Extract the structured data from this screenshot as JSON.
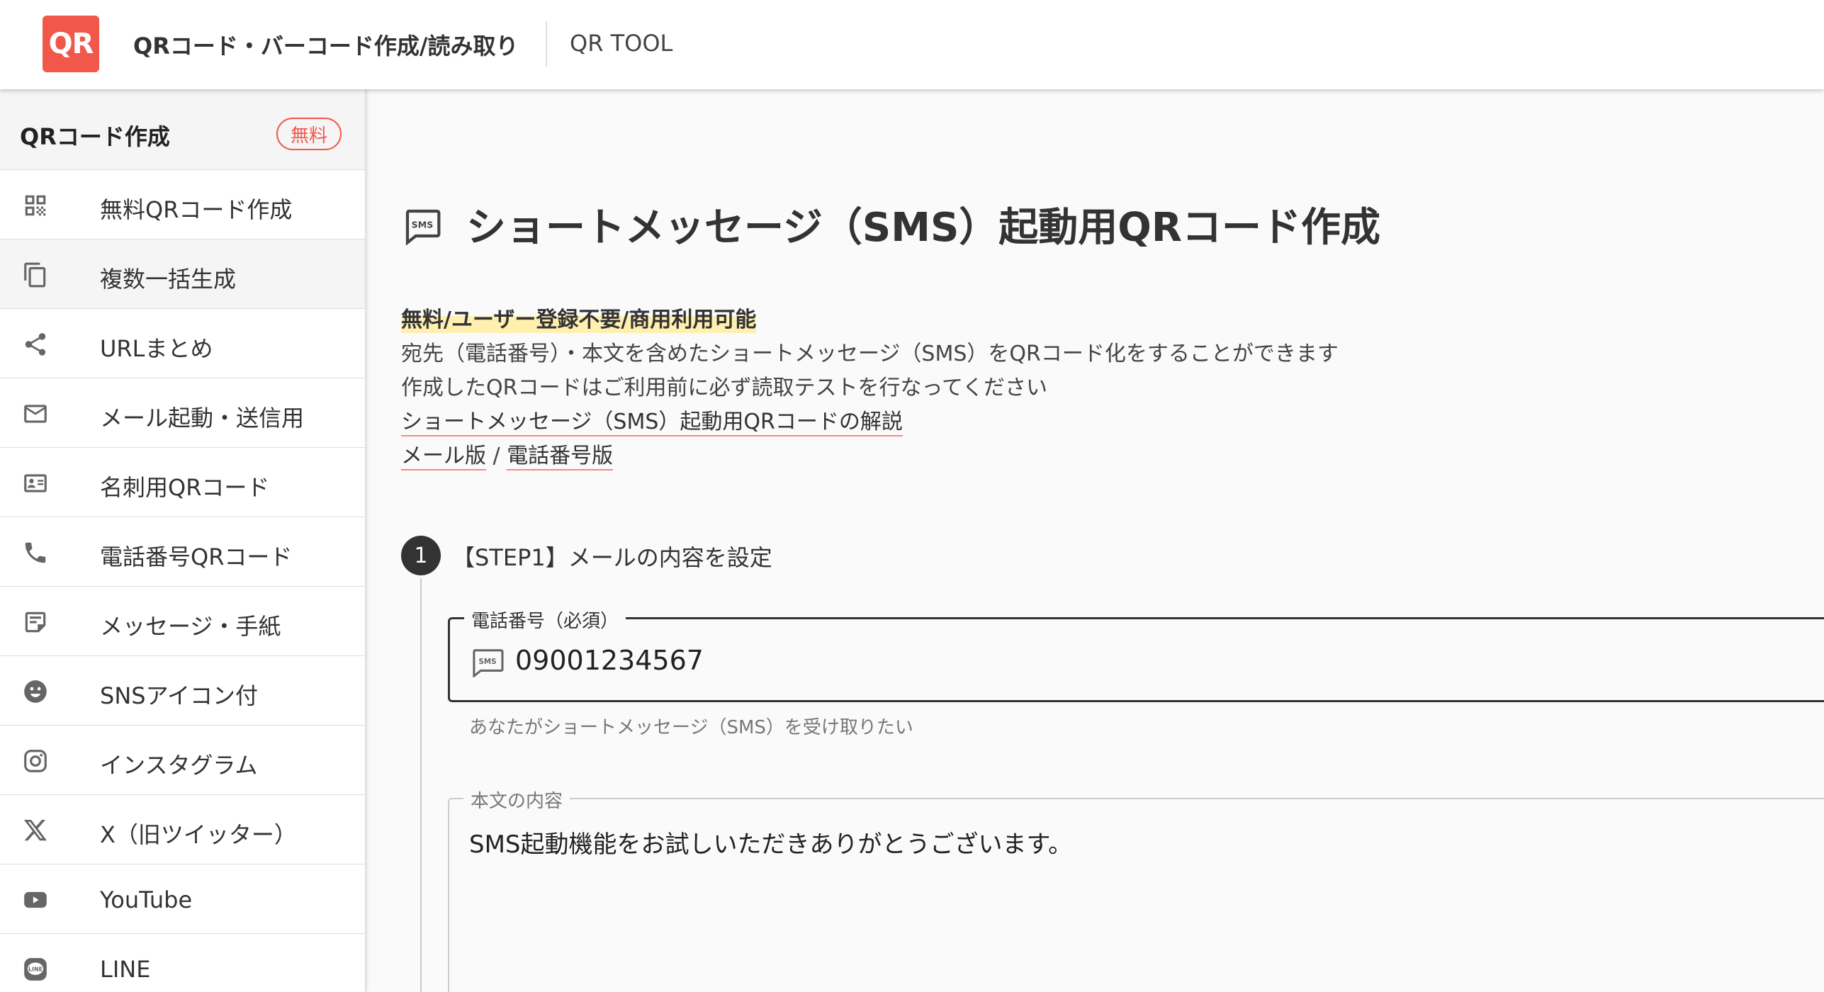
{
  "header": {
    "logo_text": "QR",
    "title": "QRコード・バーコード作成/読み取り",
    "subtitle": "QR TOOL"
  },
  "sidebar": {
    "section_title": "QRコード作成",
    "badge": "無料",
    "items": [
      {
        "label": "無料QRコード作成",
        "icon": "qr-code-icon"
      },
      {
        "label": "複数一括生成",
        "icon": "copy-icon"
      },
      {
        "label": "URLまとめ",
        "icon": "share-icon"
      },
      {
        "label": "メール起動・送信用",
        "icon": "mail-icon"
      },
      {
        "label": "名刺用QRコード",
        "icon": "id-card-icon"
      },
      {
        "label": "電話番号QRコード",
        "icon": "phone-icon"
      },
      {
        "label": "メッセージ・手紙",
        "icon": "note-icon"
      },
      {
        "label": "SNSアイコン付",
        "icon": "smiley-icon"
      },
      {
        "label": "インスタグラム",
        "icon": "instagram-icon"
      },
      {
        "label": "X（旧ツイッター）",
        "icon": "x-logo-icon"
      },
      {
        "label": "YouTube",
        "icon": "youtube-icon"
      },
      {
        "label": "LINE",
        "icon": "line-icon"
      }
    ]
  },
  "main": {
    "title": "ショートメッセージ（SMS）起動用QRコード作成",
    "highlight": "無料/ユーザー登録不要/商用利用可能",
    "desc_1": "宛先（電話番号）・本文を含めたショートメッセージ（SMS）をQRコード化をすることができます",
    "desc_2": "作成したQRコードはご利用前に必ず読取テストを行なってください",
    "link_guide": "ショートメッセージ（SMS）起動用QRコードの解説",
    "link_mail": "メール版",
    "link_sep": " / ",
    "link_phone": "電話番号版",
    "step": {
      "number": "1",
      "title": "【STEP1】メールの内容を設定"
    },
    "phone_field": {
      "label": "電話番号（必須）",
      "value": "09001234567",
      "helper": "あなたがショートメッセージ（SMS）を受け取りたい"
    },
    "body_field": {
      "label": "本文の内容",
      "value": "SMS起動機能をお試しいただきありがとうございます。"
    }
  },
  "colors": {
    "accent": "#f2584a",
    "highlight": "#fff0b0",
    "link_underline": "#f28a80"
  }
}
